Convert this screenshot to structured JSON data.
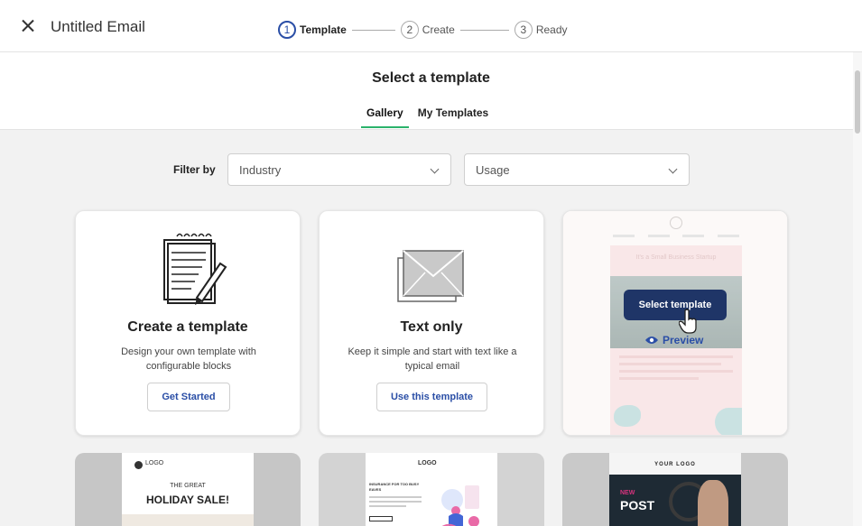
{
  "topbar": {
    "title": "Untitled Email",
    "steps": [
      {
        "num": "1",
        "label": "Template"
      },
      {
        "num": "2",
        "label": "Create"
      },
      {
        "num": "3",
        "label": "Ready"
      }
    ]
  },
  "header": {
    "heading": "Select a template",
    "tabs": [
      {
        "label": "Gallery"
      },
      {
        "label": "My Templates"
      }
    ]
  },
  "filters": {
    "label": "Filter by",
    "industry_value": "Industry",
    "usage_value": "Usage"
  },
  "cards": [
    {
      "title": "Create a template",
      "desc": "Design your own template with configurable blocks",
      "button": "Get Started"
    },
    {
      "title": "Text only",
      "desc": "Keep it simple and start with text like a typical email",
      "button": "Use this template"
    },
    {
      "template_headline": "It's a Small Business Startup",
      "select_button": "Select template",
      "preview_link": "Preview"
    }
  ],
  "bottom_cards": [
    {
      "logo": "LOGO",
      "subtitle": "THE GREAT",
      "headline": "HOLIDAY SALE!"
    },
    {
      "logo": "LOGO",
      "headline": "INSURANCE FOR TOO BUSY EAVES"
    },
    {
      "logo": "YOUR LOGO",
      "tag": "NEW",
      "headline": "POST"
    }
  ],
  "colors": {
    "accent_blue": "#2a4ea6",
    "tab_underline": "#2bb36b",
    "select_button_bg": "#1f3567"
  }
}
